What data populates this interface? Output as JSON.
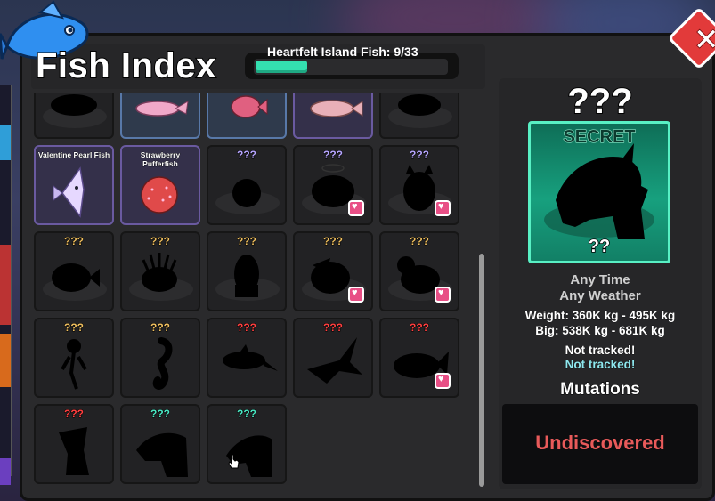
{
  "window": {
    "title": "Fish Index",
    "progress_label": "Heartfelt Island Fish: 9/33",
    "progress_fraction": 0.27,
    "close_label": "✕"
  },
  "colors": {
    "accent": "#34e0b0",
    "secret_tier": "#17a07e",
    "undiscovered": "#e85a5a",
    "tracked_cyan": "#8fe8ef"
  },
  "grid": {
    "top_row_partial": [
      {
        "label": "",
        "state": "silhouette"
      },
      {
        "label": "",
        "state": "discovered"
      },
      {
        "label": "",
        "state": "discovered"
      },
      {
        "label": "",
        "state": "discovered"
      },
      {
        "label": "",
        "state": "silhouette"
      }
    ],
    "row2": [
      {
        "label": "Valentine Pearl Fish",
        "state": "discovered",
        "icon": "angelfish-icon"
      },
      {
        "label": "Strawberry Pufferfish",
        "state": "discovered",
        "icon": "pufferfish-icon"
      },
      {
        "label": "???",
        "label_color": "#b7a6ff",
        "icon": "blob-silhouette",
        "heart": false
      },
      {
        "label": "???",
        "label_color": "#b7a6ff",
        "icon": "turtle-silhouette",
        "heart": true
      },
      {
        "label": "???",
        "label_color": "#b7a6ff",
        "icon": "cat-silhouette",
        "heart": true
      }
    ],
    "row3": [
      {
        "label": "???",
        "label_color": "#f0c060",
        "icon": "fish-silhouette",
        "heart": false
      },
      {
        "label": "???",
        "label_color": "#f0c060",
        "icon": "lionfish-silhouette",
        "heart": false
      },
      {
        "label": "???",
        "label_color": "#f0c060",
        "icon": "squid-silhouette",
        "heart": false
      },
      {
        "label": "???",
        "label_color": "#f0c060",
        "icon": "bird-silhouette",
        "heart": true
      },
      {
        "label": "???",
        "label_color": "#f0c060",
        "icon": "duck-silhouette",
        "heart": true
      }
    ],
    "row4": [
      {
        "label": "???",
        "label_color": "#f0c060",
        "icon": "jellyfish-silhouette",
        "heart": false
      },
      {
        "label": "???",
        "label_color": "#f0c060",
        "icon": "seahorse-silhouette",
        "heart": false
      },
      {
        "label": "???",
        "label_color": "#ff4040",
        "icon": "dolphin-silhouette",
        "heart": false
      },
      {
        "label": "???",
        "label_color": "#ff4040",
        "icon": "shark-silhouette",
        "heart": false
      },
      {
        "label": "???",
        "label_color": "#ff4040",
        "icon": "whale-silhouette",
        "heart": true
      }
    ],
    "row5": [
      {
        "label": "???",
        "label_color": "#ff4040",
        "icon": "tree-silhouette",
        "heart": false
      },
      {
        "label": "???",
        "label_color": "#4be8c4",
        "icon": "dragon-silhouette",
        "heart": false
      },
      {
        "label": "???",
        "label_color": "#4be8c4",
        "icon": "dragon-silhouette",
        "heart": false
      }
    ]
  },
  "detail": {
    "name": "???",
    "tier": "SECRET",
    "size_label": "??",
    "time": "Any Time",
    "weather": "Any Weather",
    "weight": "Weight: 360K kg - 495K kg",
    "big": "Big: 538K kg - 681K kg",
    "tracked_1": "Not tracked!",
    "tracked_2": "Not tracked!",
    "mutations_title": "Mutations",
    "mutations_status": "Undiscovered"
  }
}
